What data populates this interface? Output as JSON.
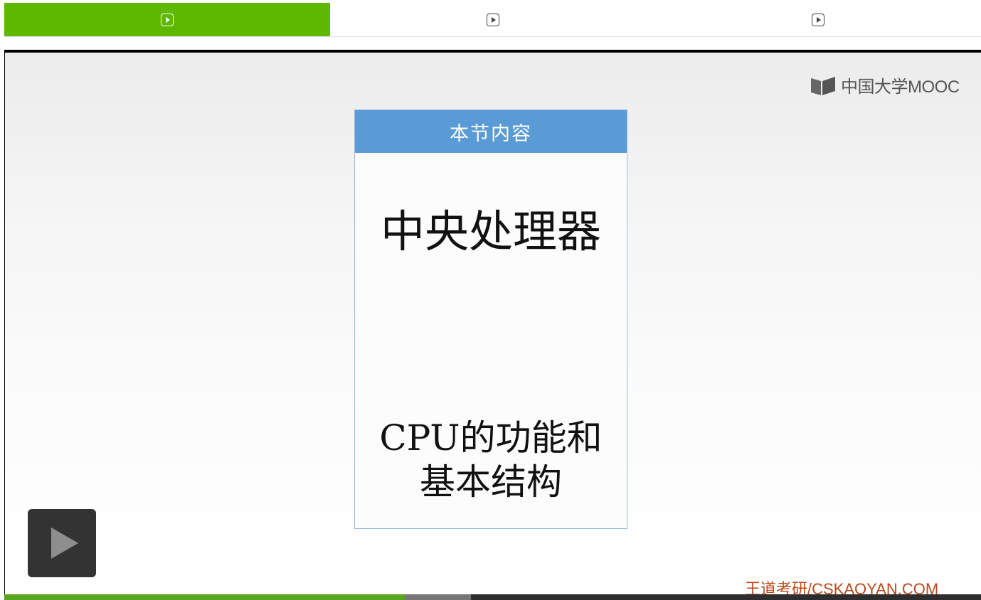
{
  "tabs": [
    {
      "icon": "play-square-icon",
      "active": true
    },
    {
      "icon": "play-square-icon",
      "active": false
    },
    {
      "icon": "play-square-icon",
      "active": false
    }
  ],
  "video": {
    "logo_text": "中国大学MOOC",
    "card": {
      "header": "本节内容",
      "title": "中央处理器",
      "subtitle_line1": "CPU的功能和",
      "subtitle_line2": "基本结构"
    },
    "watermark": "王道考研/CSKAOYAN.COM"
  },
  "player": {
    "progress_fraction": 0.41,
    "buffered_fraction": 0.478
  },
  "colors": {
    "active_tab": "#5eb800",
    "card_header": "#5b9bd5",
    "watermark": "#b84a1a",
    "progress": "#5aa61f"
  }
}
